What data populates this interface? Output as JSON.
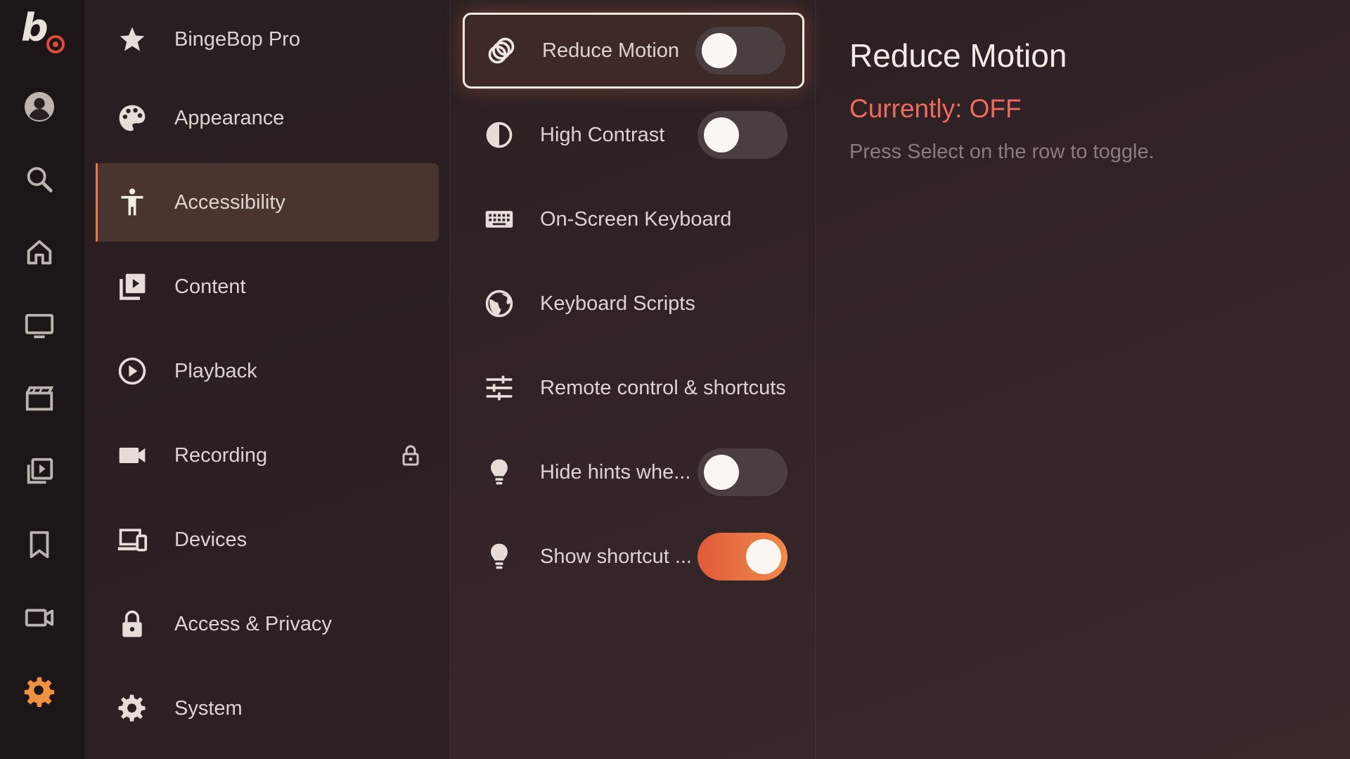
{
  "brand": {
    "logo_letter": "b"
  },
  "rail": {
    "items": [
      {
        "icon": "profile-icon"
      },
      {
        "icon": "search-icon"
      },
      {
        "icon": "home-icon"
      },
      {
        "icon": "tv-icon"
      },
      {
        "icon": "movies-icon"
      },
      {
        "icon": "library-icon"
      },
      {
        "icon": "bookmark-icon"
      },
      {
        "icon": "video-camera-icon"
      },
      {
        "icon": "settings-icon",
        "active": true
      }
    ],
    "accent": "#f0913f"
  },
  "menu": {
    "items": [
      {
        "label": "BingeBop Pro",
        "icon": "star-icon"
      },
      {
        "label": "Appearance",
        "icon": "palette-icon"
      },
      {
        "label": "Accessibility",
        "icon": "accessibility-icon",
        "active": true
      },
      {
        "label": "Content",
        "icon": "content-library-icon"
      },
      {
        "label": "Playback",
        "icon": "play-circle-icon"
      },
      {
        "label": "Recording",
        "icon": "camera-icon",
        "locked": true
      },
      {
        "label": "Devices",
        "icon": "devices-icon"
      },
      {
        "label": "Access & Privacy",
        "icon": "lock-icon"
      },
      {
        "label": "System",
        "icon": "gear-icon"
      }
    ]
  },
  "options": {
    "items": [
      {
        "label": "Reduce Motion",
        "icon": "motion-rings-icon",
        "toggle": "off",
        "focused": true
      },
      {
        "label": "High Contrast",
        "icon": "contrast-icon",
        "toggle": "off"
      },
      {
        "label": "On-Screen Keyboard",
        "icon": "keyboard-icon"
      },
      {
        "label": "Keyboard Scripts",
        "icon": "globe-icon"
      },
      {
        "label": "Remote control & shortcuts",
        "icon": "sliders-icon"
      },
      {
        "label": "Hide hints whe...",
        "icon": "lightbulb-icon",
        "toggle": "off"
      },
      {
        "label": "Show shortcut ...",
        "icon": "lightbulb-icon",
        "toggle": "on"
      }
    ],
    "toggle_on_color": "#f07a45"
  },
  "detail": {
    "title": "Reduce Motion",
    "status": "Currently: OFF",
    "hint": "Press Select on the row to toggle.",
    "status_color": "#f06a5e"
  }
}
